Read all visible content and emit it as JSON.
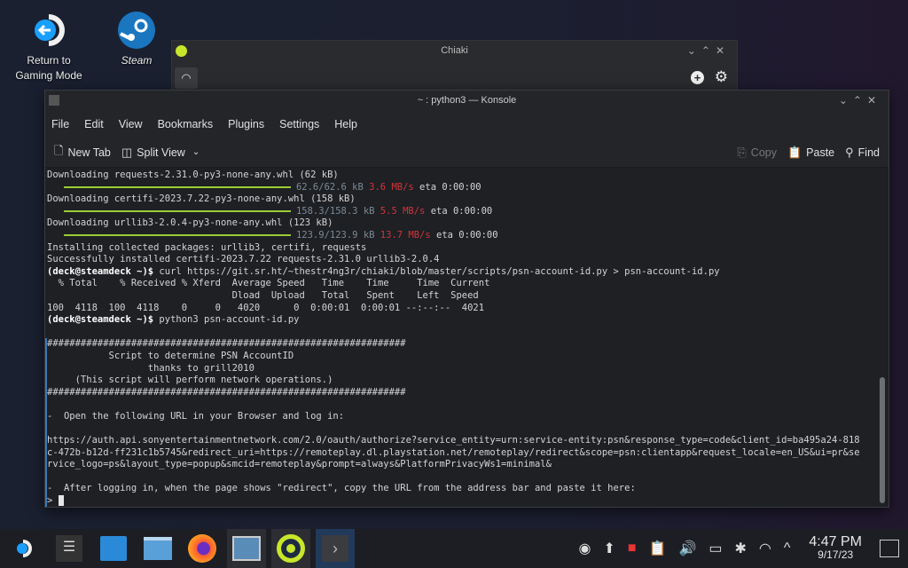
{
  "desktop": {
    "icons": [
      {
        "label": "Return to\nGaming Mode",
        "icon": "return-gaming-mode-icon"
      },
      {
        "label": "Steam",
        "icon": "steam-icon"
      }
    ]
  },
  "chiaki": {
    "title": "Chiaki"
  },
  "konsole": {
    "title": "~ : python3 — Konsole",
    "menu": [
      "File",
      "Edit",
      "View",
      "Bookmarks",
      "Plugins",
      "Settings",
      "Help"
    ],
    "toolbar": {
      "new_tab": "New Tab",
      "split_view": "Split View",
      "copy": "Copy",
      "paste": "Paste",
      "find": "Find"
    },
    "lines": [
      [
        {
          "t": "Downloading requests-2.31.0-py3-none-any.whl (62 kB)"
        }
      ],
      [
        {
          "s": "bar"
        },
        {
          "s": "pb",
          "t": "62.6/62.6 kB "
        },
        {
          "s": "sp",
          "t": "3.6 MB/s"
        },
        {
          "t": " eta 0:00:00"
        }
      ],
      [
        {
          "t": "Downloading certifi-2023.7.22-py3-none-any.whl (158 kB)"
        }
      ],
      [
        {
          "s": "bar"
        },
        {
          "s": "pb",
          "t": "158.3/158.3 kB "
        },
        {
          "s": "sp",
          "t": "5.5 MB/s"
        },
        {
          "t": " eta 0:00:00"
        }
      ],
      [
        {
          "t": "Downloading urllib3-2.0.4-py3-none-any.whl (123 kB)"
        }
      ],
      [
        {
          "s": "bar"
        },
        {
          "s": "pb",
          "t": "123.9/123.9 kB "
        },
        {
          "s": "sp",
          "t": "13.7 MB/s"
        },
        {
          "t": " eta 0:00:00"
        }
      ],
      [
        {
          "t": "Installing collected packages: urllib3, certifi, requests"
        }
      ],
      [
        {
          "t": "Successfully installed certifi-2023.7.22 requests-2.31.0 urllib3-2.0.4"
        }
      ],
      [
        {
          "s": "pr",
          "t": "(deck@steamdeck ~)$"
        },
        {
          "t": " curl https://git.sr.ht/~thestr4ng3r/chiaki/blob/master/scripts/psn-account-id.py > psn-account-id.py"
        }
      ],
      [
        {
          "t": "  % Total    % Received % Xferd  Average Speed   Time    Time     Time  Current"
        }
      ],
      [
        {
          "t": "                                 Dload  Upload   Total   Spent    Left  Speed"
        }
      ],
      [
        {
          "t": "100  4118  100  4118    0     0   4020      0  0:00:01  0:00:01 --:--:--  4021"
        }
      ],
      [
        {
          "s": "pr",
          "t": "(deck@steamdeck ~)$"
        },
        {
          "t": " python3 psn-account-id.py"
        }
      ],
      [],
      [
        {
          "t": "################################################################"
        }
      ],
      [
        {
          "t": "           Script to determine PSN AccountID"
        }
      ],
      [
        {
          "t": "                  thanks to grill2010"
        }
      ],
      [
        {
          "t": "     (This script will perform network operations.)"
        }
      ],
      [
        {
          "t": "################################################################"
        }
      ],
      [],
      [
        {
          "t": "-  Open the following URL in your Browser and log in:"
        }
      ],
      [],
      [
        {
          "t": "https://auth.api.sonyentertainmentnetwork.com/2.0/oauth/authorize?service_entity=urn:service-entity:psn&response_type=code&client_id=ba495a24-818"
        }
      ],
      [
        {
          "t": "c-472b-b12d-ff231c1b5745&redirect_uri=https://remoteplay.dl.playstation.net/remoteplay/redirect&scope=psn:clientapp&request_locale=en_US&ui=pr&se"
        }
      ],
      [
        {
          "t": "rvice_logo=ps&layout_type=popup&smcid=remoteplay&prompt=always&PlatformPrivacyWs1=minimal&"
        }
      ],
      [],
      [
        {
          "t": "-  After logging in, when the page shows \"redirect\", copy the URL from the address bar and paste it here:"
        }
      ],
      [
        {
          "t": "> "
        },
        {
          "s": "cursor"
        }
      ]
    ]
  },
  "taskbar": {
    "apps": [
      "steamos-menu-icon",
      "settings-sliders-icon",
      "discover-store-icon",
      "file-manager-icon",
      "firefox-icon",
      "media-app-icon",
      "chiaki-icon",
      "konsole-icon"
    ],
    "tray": [
      "steam-tray-icon",
      "update-icon",
      "screen-record-icon",
      "clipboard-icon",
      "volume-icon",
      "battery-icon",
      "bluetooth-icon",
      "wifi-icon",
      "tray-expand-icon"
    ],
    "time": "4:47 PM",
    "date": "9/17/23"
  },
  "colors": {
    "accent": "#3c78b4",
    "progress": "#9acd32",
    "speed": "#d0343a"
  }
}
